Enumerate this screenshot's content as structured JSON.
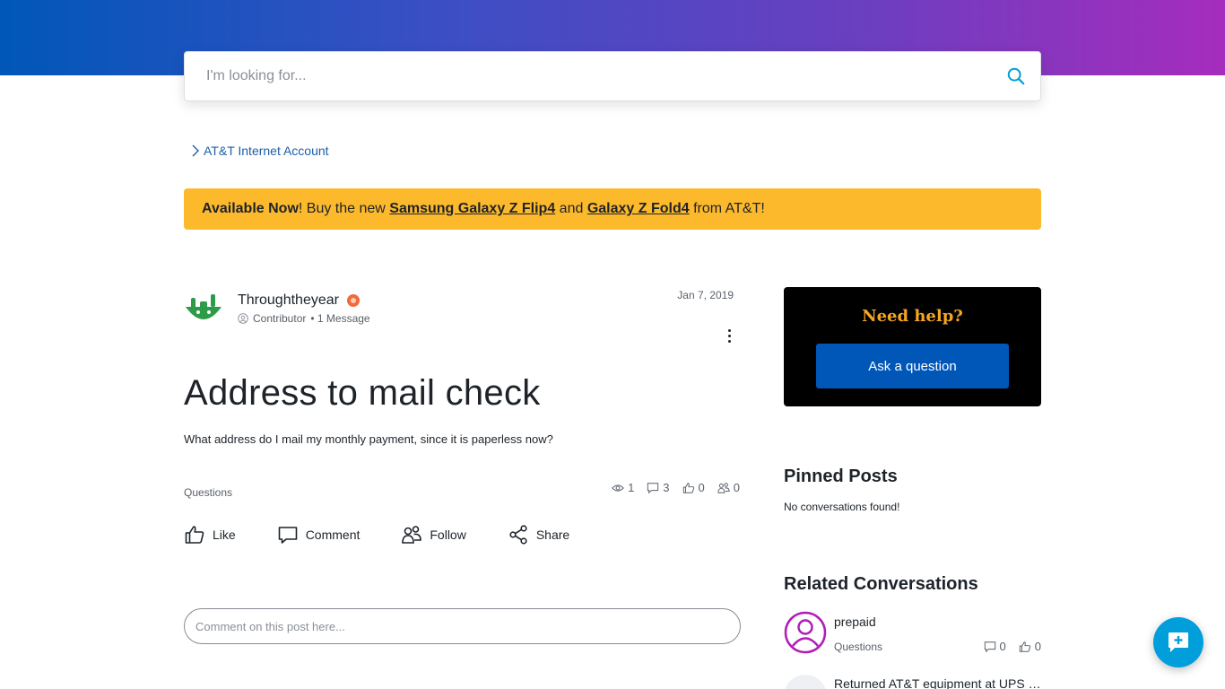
{
  "search": {
    "placeholder": "I'm looking for..."
  },
  "breadcrumb": {
    "items": [
      {
        "label": "AT&T Internet Account"
      }
    ]
  },
  "promo": {
    "prefix": "Available Now",
    "text1": "! Buy the new ",
    "link1": "Samsung Galaxy Z Flip4",
    "text2": " and ",
    "link2": "Galaxy Z Fold4",
    "text3": " from AT&T!",
    "bg_color": "#fdb92c"
  },
  "post": {
    "author": {
      "name": "Throughtheyear",
      "role": "Contributor",
      "messages": "• 1 Message"
    },
    "date": "Jan 7, 2019",
    "title": "Address to mail check",
    "body": "What address do I mail my monthly payment, since it is paperless now?",
    "tag": "Questions",
    "stats": {
      "views": "1",
      "comments": "3",
      "likes": "0",
      "followers": "0"
    },
    "actions": {
      "like": "Like",
      "comment": "Comment",
      "follow": "Follow",
      "share": "Share"
    }
  },
  "comment_box": {
    "placeholder": "Comment on this post here..."
  },
  "sidebar": {
    "help": {
      "title": "Need help?",
      "button": "Ask a question"
    },
    "pinned": {
      "heading": "Pinned Posts",
      "empty": "No conversations found!"
    },
    "related": {
      "heading": "Related Conversations",
      "items": [
        {
          "title": "prepaid",
          "tag": "Questions",
          "comments": "0",
          "likes": "0"
        },
        {
          "title": "Returned AT&T equipment at UPS S...",
          "tag": "",
          "comments": "",
          "likes": ""
        }
      ]
    }
  },
  "colors": {
    "brand_blue": "#0057b8",
    "accent_cyan": "#009fdb",
    "gradient_end": "#a62cbd",
    "help_title": "#f5a623"
  }
}
